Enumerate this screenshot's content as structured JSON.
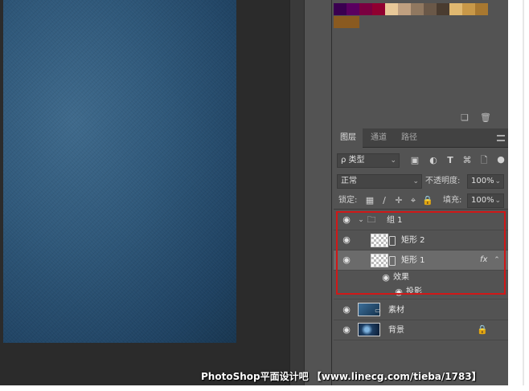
{
  "swatches": {
    "colors_row1": [
      "#3a0050",
      "#5a0060",
      "#7a0040",
      "#900030",
      "#e8c898",
      "#c0a080",
      "#907860",
      "#6a5848",
      "#4a3c30",
      "#e0b870",
      "#c89848",
      "#a87830"
    ],
    "colors_row2": [
      "#8a5a20"
    ]
  },
  "swatch_tools": {
    "new_icon": "new-swatch-icon",
    "delete_icon": "trash-icon"
  },
  "layers": {
    "tabs": [
      {
        "label": "图层",
        "active": true
      },
      {
        "label": "通道",
        "active": false
      },
      {
        "label": "路径",
        "active": false
      }
    ],
    "filter": {
      "kind_label": "ρ 类型"
    },
    "blend": {
      "mode": "正常",
      "opacity_label": "不透明度:",
      "opacity_value": "100%"
    },
    "lock": {
      "label": "锁定:",
      "fill_label": "填充:",
      "fill_value": "100%"
    },
    "items": [
      {
        "name": "组 1",
        "type": "group"
      },
      {
        "name": "矩形 2",
        "type": "shape"
      },
      {
        "name": "矩形 1",
        "type": "shape",
        "fx": "fx",
        "selected": true
      },
      {
        "name": "效果",
        "type": "effects"
      },
      {
        "name": "投影",
        "type": "effect"
      },
      {
        "name": "素材",
        "type": "photo"
      },
      {
        "name": "背景",
        "type": "background"
      }
    ]
  },
  "watermark": "PhotoShop平面设计吧 【www.linecg.com/tieba/1783】"
}
